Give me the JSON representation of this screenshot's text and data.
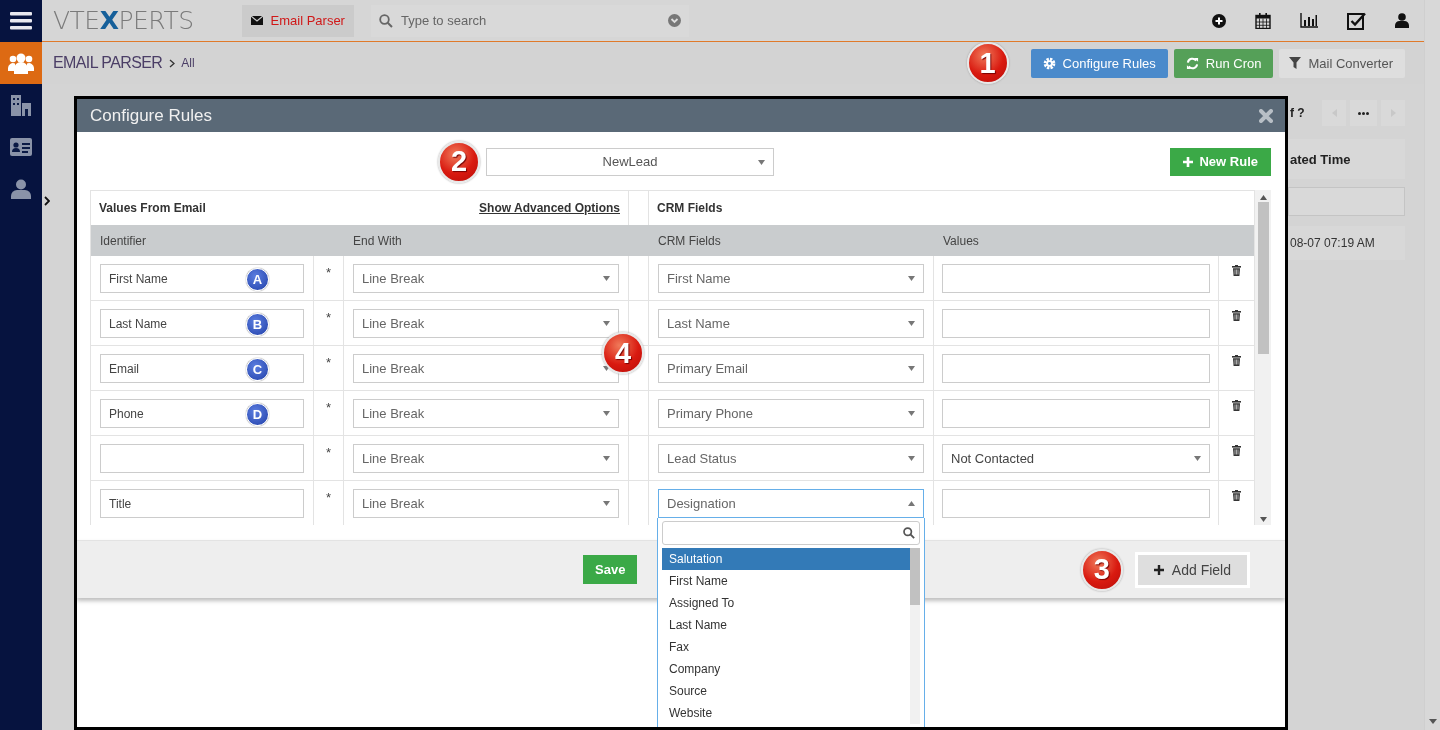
{
  "app_bar": {
    "logo": "VTEXPERTS",
    "module_tab": "Email Parser",
    "search": {
      "placeholder": "Type to search"
    }
  },
  "sidebar": {
    "items": [
      {
        "kind": "contacts",
        "selected": true
      },
      {
        "kind": "organizations",
        "selected": false
      },
      {
        "kind": "card",
        "selected": false
      },
      {
        "kind": "user",
        "selected": false
      }
    ]
  },
  "breadcrumb": {
    "module": "EMAIL PARSER",
    "view": "All"
  },
  "actions_callout": "1",
  "actions": [
    {
      "label": "Configure Rules",
      "kind": "primary"
    },
    {
      "label": "Run Cron",
      "kind": "success"
    },
    {
      "label": "Mail Converter",
      "kind": "default"
    }
  ],
  "background_list": {
    "page_info": "f ?",
    "column_header": "ated Time",
    "row_time": "08-07 07:19 AM"
  },
  "modal": {
    "title": "Configure Rules",
    "rule_callout": "2",
    "rule_select": "NewLead",
    "new_rule_button": "New Rule",
    "table": {
      "group_left": "Values From Email",
      "advanced_link": "Show Advanced Options",
      "group_right": "CRM Fields",
      "columns": [
        "Identifier",
        "End With",
        "CRM Fields",
        "Values"
      ],
      "callout": "4",
      "rows": [
        {
          "identifier": "First Name",
          "marker": "A",
          "required_mark": "*",
          "end_with": "Line Break",
          "crm_field": "First Name",
          "crm_open": false,
          "value": {
            "kind": "input"
          }
        },
        {
          "identifier": "Last Name",
          "marker": "B",
          "required_mark": "*",
          "end_with": "Line Break",
          "crm_field": "Last Name",
          "crm_open": false,
          "value": {
            "kind": "input"
          }
        },
        {
          "identifier": "Email",
          "marker": "C",
          "required_mark": "*",
          "end_with": "Line Break",
          "crm_field": "Primary Email",
          "crm_open": false,
          "value": {
            "kind": "input"
          }
        },
        {
          "identifier": "Phone",
          "marker": "D",
          "required_mark": "*",
          "end_with": "Line Break",
          "crm_field": "Primary Phone",
          "crm_open": false,
          "value": {
            "kind": "input"
          }
        },
        {
          "required_mark": "*",
          "end_with": "Line Break",
          "crm_field": "Lead Status",
          "crm_open": false,
          "value": {
            "kind": "select",
            "text": "Not Contacted"
          }
        },
        {
          "identifier": "Title",
          "required_mark": "*",
          "end_with": "Line Break",
          "crm_field": "Designation",
          "crm_open": true,
          "value": {
            "kind": "input"
          }
        }
      ]
    },
    "save_button": "Save",
    "add_field_callout": "3",
    "add_field_button": "Add Field",
    "dropdown": {
      "options": [
        {
          "label": "Salutation",
          "selected": true
        },
        {
          "label": "First Name",
          "selected": false
        },
        {
          "label": "Assigned To",
          "selected": false
        },
        {
          "label": "Last Name",
          "selected": false
        },
        {
          "label": "Fax",
          "selected": false
        },
        {
          "label": "Company",
          "selected": false
        },
        {
          "label": "Source",
          "selected": false
        },
        {
          "label": "Website",
          "selected": false
        }
      ]
    }
  }
}
